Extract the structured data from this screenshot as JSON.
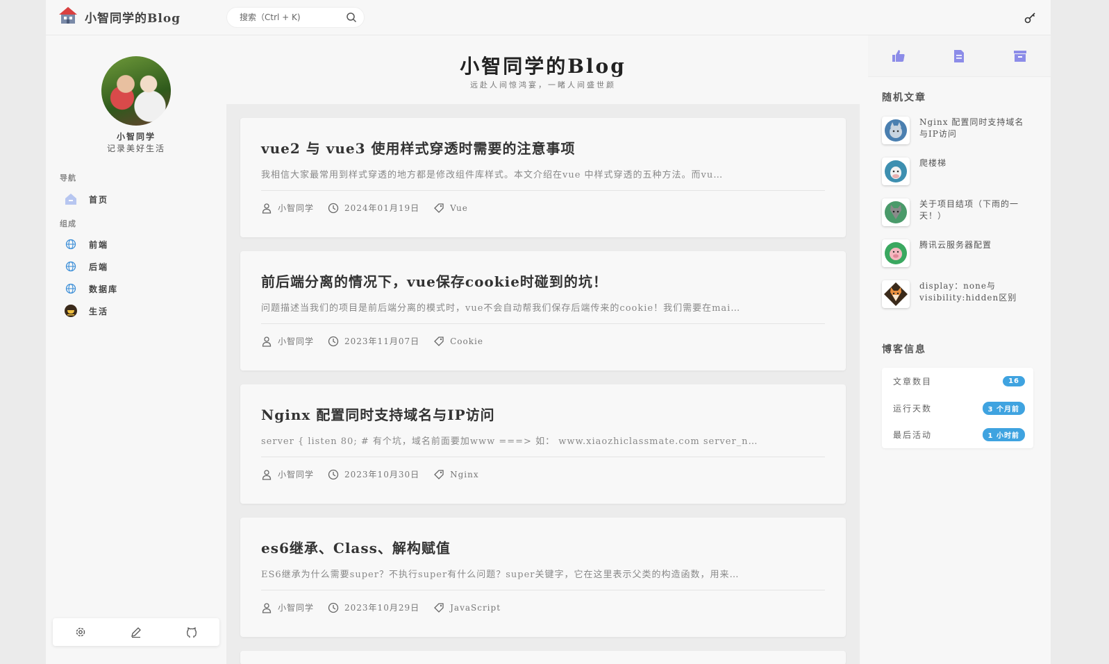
{
  "header": {
    "site_name": "小智同学的Blog",
    "search_placeholder": "搜索（Ctrl + K)"
  },
  "sidebar": {
    "author_name": "小智同学",
    "author_motto": "记录美好生活",
    "nav_heading": "导航",
    "nav_items": [
      {
        "label": "首页",
        "icon": "home-icon"
      }
    ],
    "category_heading": "组成",
    "categories": [
      {
        "label": "前端",
        "icon": "globe-icon"
      },
      {
        "label": "后端",
        "icon": "globe-icon"
      },
      {
        "label": "数据库",
        "icon": "globe-icon"
      },
      {
        "label": "生活",
        "icon": "coffee-icon"
      }
    ],
    "footer_icons": [
      "settings-icon",
      "edit-icon",
      "github-icon"
    ]
  },
  "hero": {
    "title": "小智同学的Blog",
    "subtitle": "远赴人间惊鸿宴，一睹人间盛世颜"
  },
  "posts": [
    {
      "title": "vue2 与 vue3 使用样式穿透时需要的注意事项",
      "excerpt": "我相信大家最常用到样式穿透的地方都是修改组件库样式。本文介绍在vue 中样式穿透的五种方法。而vu…",
      "author": "小智同学",
      "date": "2024年01月19日",
      "tag": "Vue"
    },
    {
      "title": "前后端分离的情况下，vue保存cookie时碰到的坑！",
      "excerpt": "问题描述当我们的项目是前后端分离的模式时，vue不会自动帮我们保存后端传来的cookie！我们需要在mai…",
      "author": "小智同学",
      "date": "2023年11月07日",
      "tag": "Cookie"
    },
    {
      "title": "Nginx 配置同时支持域名与IP访问",
      "excerpt": "server {   listen 80; # 有个坑，域名前面要加www ===> 如： www.xiaozhiclassmate.com   server_n…",
      "author": "小智同学",
      "date": "2023年10月30日",
      "tag": "Nginx"
    },
    {
      "title": "es6继承、Class、解构赋值",
      "excerpt": "ES6继承为什么需要super？不执行super有什么问题？super关键字，它在这里表示父类的构造函数，用来…",
      "author": "小智同学",
      "date": "2023年10月29日",
      "tag": "JavaScript"
    }
  ],
  "right": {
    "random_heading": "随机文章",
    "random_posts": [
      {
        "title": "Nginx 配置同时支持域名与IP访问",
        "icon": "cat-avatar-icon",
        "color": "#4a7fb0"
      },
      {
        "title": "爬楼梯",
        "icon": "cow-avatar-icon",
        "color": "#3d8fb0"
      },
      {
        "title": "关于项目结项（下雨的一天！）",
        "icon": "wolf-avatar-icon",
        "color": "#4a9a6a"
      },
      {
        "title": "腾讯云服务器配置",
        "icon": "pig-avatar-icon",
        "color": "#3aa860"
      },
      {
        "title": "display：none与visibility:hidden区别",
        "icon": "fox-avatar-icon",
        "color": "#8a5a30"
      }
    ],
    "info_heading": "博客信息",
    "info": [
      {
        "label": "文章数目",
        "value": "16"
      },
      {
        "label": "运行天数",
        "value": "3 个月前"
      },
      {
        "label": "最后活动",
        "value": "1 小时前"
      }
    ]
  },
  "colors": {
    "accent": "#3fa3e0",
    "icon_purple": "#8c8ce8",
    "page_bg": "#f7f7f7"
  }
}
